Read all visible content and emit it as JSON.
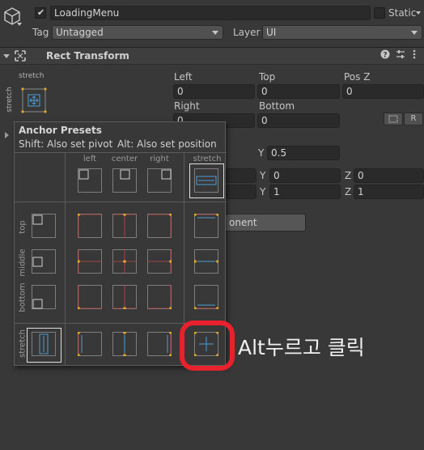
{
  "header": {
    "object_name": "LoadingMenu",
    "active_checked": true,
    "static_label": "Static",
    "tag_label": "Tag",
    "tag_value": "Untagged",
    "layer_label": "Layer",
    "layer_value": "UI"
  },
  "rect_transform": {
    "title": "Rect Transform",
    "anchor_label_top": "stretch",
    "anchor_label_side": "stretch",
    "fields": {
      "left_label": "Left",
      "left_value": "0",
      "top_label": "Top",
      "top_value": "0",
      "posz_label": "Pos Z",
      "posz_value": "0",
      "right_label": "Right",
      "right_value": "0",
      "bottom_label": "Bottom",
      "bottom_value": "0"
    },
    "raw_button": "R",
    "pivot_y_label": "Y",
    "pivot_y_value": "0.5",
    "rot_y_label": "Y",
    "rot_y_value": "0",
    "rot_z_label": "Z",
    "rot_z_value": "0",
    "scale_y_label": "Y",
    "scale_y_value": "1",
    "scale_z_label": "Z",
    "scale_z_value": "1",
    "add_component_partial": "onent"
  },
  "anchor_presets": {
    "title": "Anchor Presets",
    "hint_pivot": "Shift: Also set pivot",
    "hint_position": "Alt: Also set position",
    "columns": [
      "left",
      "center",
      "right",
      "stretch"
    ],
    "rows": [
      "top",
      "middle",
      "bottom",
      "stretch"
    ]
  },
  "annotation": {
    "text": "Alt누르고 클릭",
    "ring_color": "#e8212c"
  },
  "colors": {
    "accent_blue": "#4a9ed6",
    "anchor_red": "#c24a4a",
    "anchor_yellow": "#e0a82a"
  }
}
